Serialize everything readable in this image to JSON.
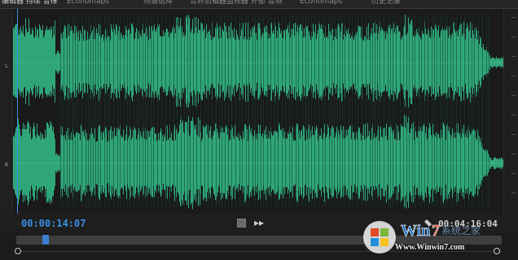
{
  "tabs": [
    "编辑器 持续 音律",
    "Economaps",
    "频谱选择",
    "合并剪辑器监视器 外部 音频",
    "Economaps",
    "历史记录"
  ],
  "channels": {
    "left_label": "L",
    "right_label": "R"
  },
  "colors": {
    "waveform": "#2fa67a",
    "waveform_bg": "#1a1a1a",
    "playhead": "#3a8ee6",
    "current_time": "#3a8ee6"
  },
  "transport": {
    "current_time": "00:00:14:07",
    "duration": "00:04:16:04",
    "stop_icon": "stop-icon",
    "fast_forward_icon": "fast-forward-icon"
  },
  "navigator": {
    "playhead_position_fraction": 0.06
  },
  "watermark": {
    "url": "Www.Winwin7.com",
    "logo": "windows-logo"
  }
}
